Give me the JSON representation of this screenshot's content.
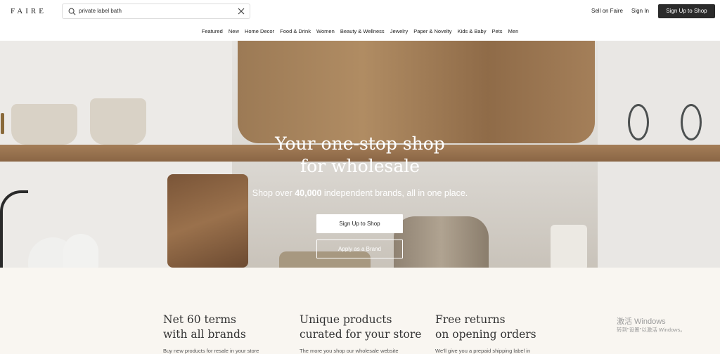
{
  "header": {
    "logo": "FAIRE",
    "search": {
      "value": "private label bath"
    },
    "sell_link": "Sell on Faire",
    "signin_link": "Sign In",
    "signup_button": "Sign Up to Shop"
  },
  "nav": {
    "items": [
      "Featured",
      "New",
      "Home Decor",
      "Food & Drink",
      "Women",
      "Beauty & Wellness",
      "Jewelry",
      "Paper & Novelty",
      "Kids & Baby",
      "Pets",
      "Men"
    ]
  },
  "hero": {
    "title_line1": "Your one-stop shop",
    "title_line2": "for wholesale",
    "subtitle_prefix": "Shop over ",
    "subtitle_count": "40,000",
    "subtitle_suffix": " independent brands, all in one place.",
    "primary_button": "Sign Up to Shop",
    "secondary_button": "Apply as a Brand"
  },
  "features": [
    {
      "title_line1": "Net 60 terms",
      "title_line2": "with all brands",
      "text": "Buy new products for resale in your store"
    },
    {
      "title_line1": "Unique products",
      "title_line2": "curated for your store",
      "text": "The more you shop our wholesale website"
    },
    {
      "title_line1": "Free returns",
      "title_line2": "on opening orders",
      "text": "We'll give you a prepaid shipping label in"
    }
  ],
  "watermark": {
    "line1": "激活 Windows",
    "line2": "转到\"设置\"以激活 Windows。"
  }
}
